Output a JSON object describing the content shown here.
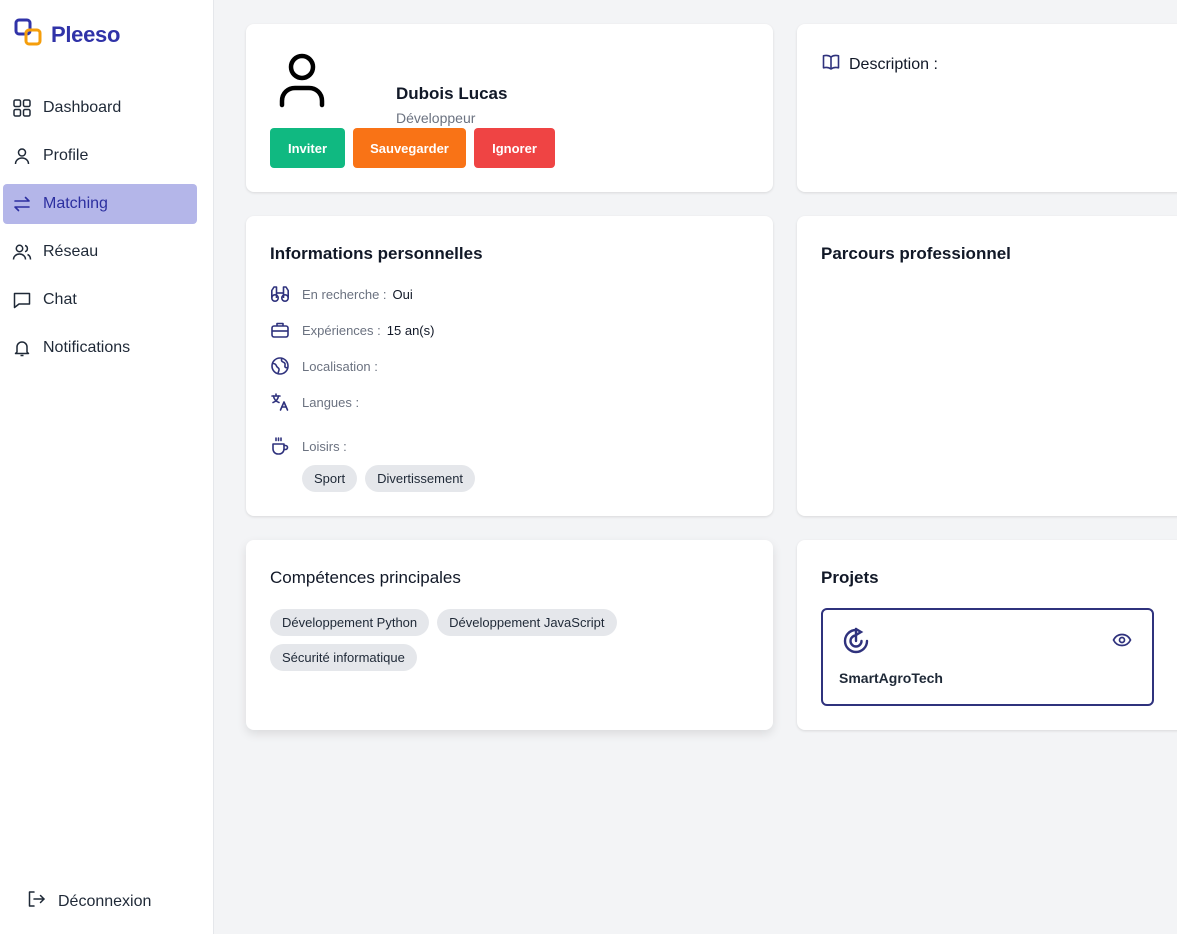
{
  "app": {
    "name": "Pleeso"
  },
  "sidebar": {
    "items": [
      {
        "label": "Dashboard",
        "icon": "grid-icon"
      },
      {
        "label": "Profile",
        "icon": "user-icon"
      },
      {
        "label": "Matching",
        "icon": "arrows-exchange-icon",
        "active": true
      },
      {
        "label": "Réseau",
        "icon": "users-icon"
      },
      {
        "label": "Chat",
        "icon": "message-icon"
      },
      {
        "label": "Notifications",
        "icon": "bell-icon"
      }
    ],
    "logout_label": "Déconnexion"
  },
  "profile": {
    "name": "Dubois Lucas",
    "role": "Développeur",
    "buttons": {
      "invite": "Inviter",
      "save": "Sauvegarder",
      "ignore": "Ignorer"
    }
  },
  "description": {
    "title": "Description :"
  },
  "info": {
    "title": "Informations personnelles",
    "rows": {
      "searching": {
        "label": "En recherche :",
        "value": "Oui"
      },
      "experience": {
        "label": "Expériences :",
        "value": "15 an(s)"
      },
      "location": {
        "label": "Localisation :",
        "value": ""
      },
      "languages": {
        "label": "Langues :",
        "value": ""
      },
      "hobbies": {
        "label": "Loisirs :"
      }
    },
    "hobbies": [
      "Sport",
      "Divertissement"
    ]
  },
  "parcours": {
    "title": "Parcours professionnel"
  },
  "skills": {
    "title": "Compétences principales",
    "items": [
      "Développement Python",
      "Développement JavaScript",
      "Sécurité informatique"
    ]
  },
  "projects": {
    "title": "Projets",
    "items": [
      {
        "name": "SmartAgroTech"
      }
    ]
  },
  "colors": {
    "brand": "#3033a8",
    "active_nav_bg": "#b4b6e9",
    "invite": "#10b981",
    "save": "#f97316",
    "ignore": "#ef4444"
  }
}
